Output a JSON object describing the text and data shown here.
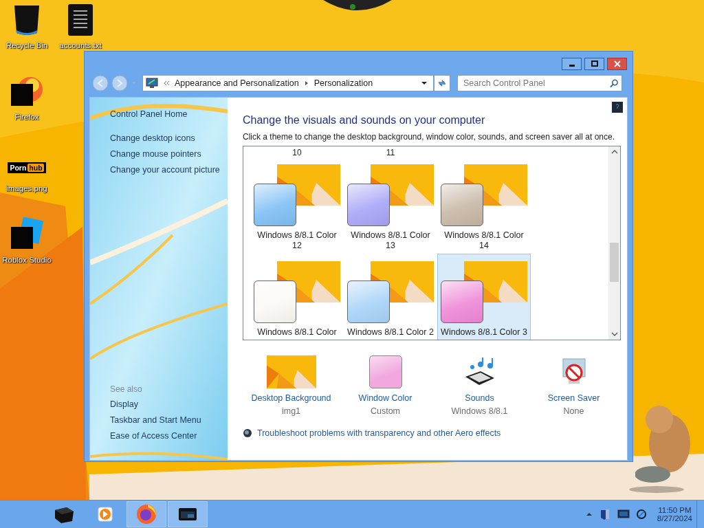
{
  "desktop_icons": [
    {
      "kind": "bin",
      "label": "Recycle Bin"
    },
    {
      "kind": "text-file",
      "label": "accounts.txt"
    },
    {
      "kind": "firefox-tile",
      "label": "Firefox"
    },
    {
      "kind": "logo",
      "label": "images.png",
      "logo_text": [
        "Porn",
        "hub"
      ]
    },
    {
      "kind": "studio-tile",
      "label": "Roblox Studio"
    }
  ],
  "window": {
    "address": {
      "crumbs": [
        "Appearance and Personalization",
        "Personalization"
      ]
    },
    "search": {
      "placeholder": "Search Control Panel"
    },
    "sidebar": {
      "home": "Control Panel Home",
      "links": [
        "Change desktop icons",
        "Change mouse pointers",
        "Change your account picture"
      ],
      "see_also_heading": "See also",
      "see_also": [
        "Display",
        "Taskbar and Start Menu",
        "Ease of Access Center"
      ]
    },
    "main": {
      "heading": "Change the visuals and sounds on your computer",
      "description": "Click a theme to change the desktop background, window color, sounds, and screen saver all at once.",
      "partial_labels": [
        "10",
        "11"
      ],
      "themes": [
        {
          "label": "Windows 8/8.1 Color 12",
          "color": "#7fbff4",
          "selected": false
        },
        {
          "label": "Windows 8/8.1 Color 13",
          "color": "#a7a5f7",
          "selected": false
        },
        {
          "label": "Windows 8/8.1 Color 14",
          "color": "#c7b7a4",
          "selected": false
        },
        {
          "label": "Windows 8/8.1 Color",
          "color": "#fbf8f4",
          "selected": false
        },
        {
          "label": "Windows 8/8.1 Color 2",
          "color": "#a8d3f8",
          "selected": false
        },
        {
          "label": "Windows 8/8.1 Color 3",
          "color": "#ef88d6",
          "selected": true
        }
      ],
      "settings": [
        {
          "kind": "background",
          "label": "Desktop Background",
          "value": "img1"
        },
        {
          "kind": "color",
          "label": "Window Color",
          "value": "Custom",
          "color": "#f2a8de"
        },
        {
          "kind": "sounds",
          "label": "Sounds",
          "value": "Windows 8/8.1"
        },
        {
          "kind": "screensaver",
          "label": "Screen Saver",
          "value": "None"
        }
      ],
      "troubleshoot": "Troubleshoot problems with transparency and other Aero effects"
    }
  },
  "taskbar": {
    "apps": [
      {
        "kind": "folder",
        "open": false
      },
      {
        "kind": "media",
        "open": false
      },
      {
        "kind": "firefox",
        "open": true
      },
      {
        "kind": "window",
        "open": true
      }
    ],
    "clock": {
      "time": "11:50 PM",
      "date": "8/27/2024"
    }
  }
}
